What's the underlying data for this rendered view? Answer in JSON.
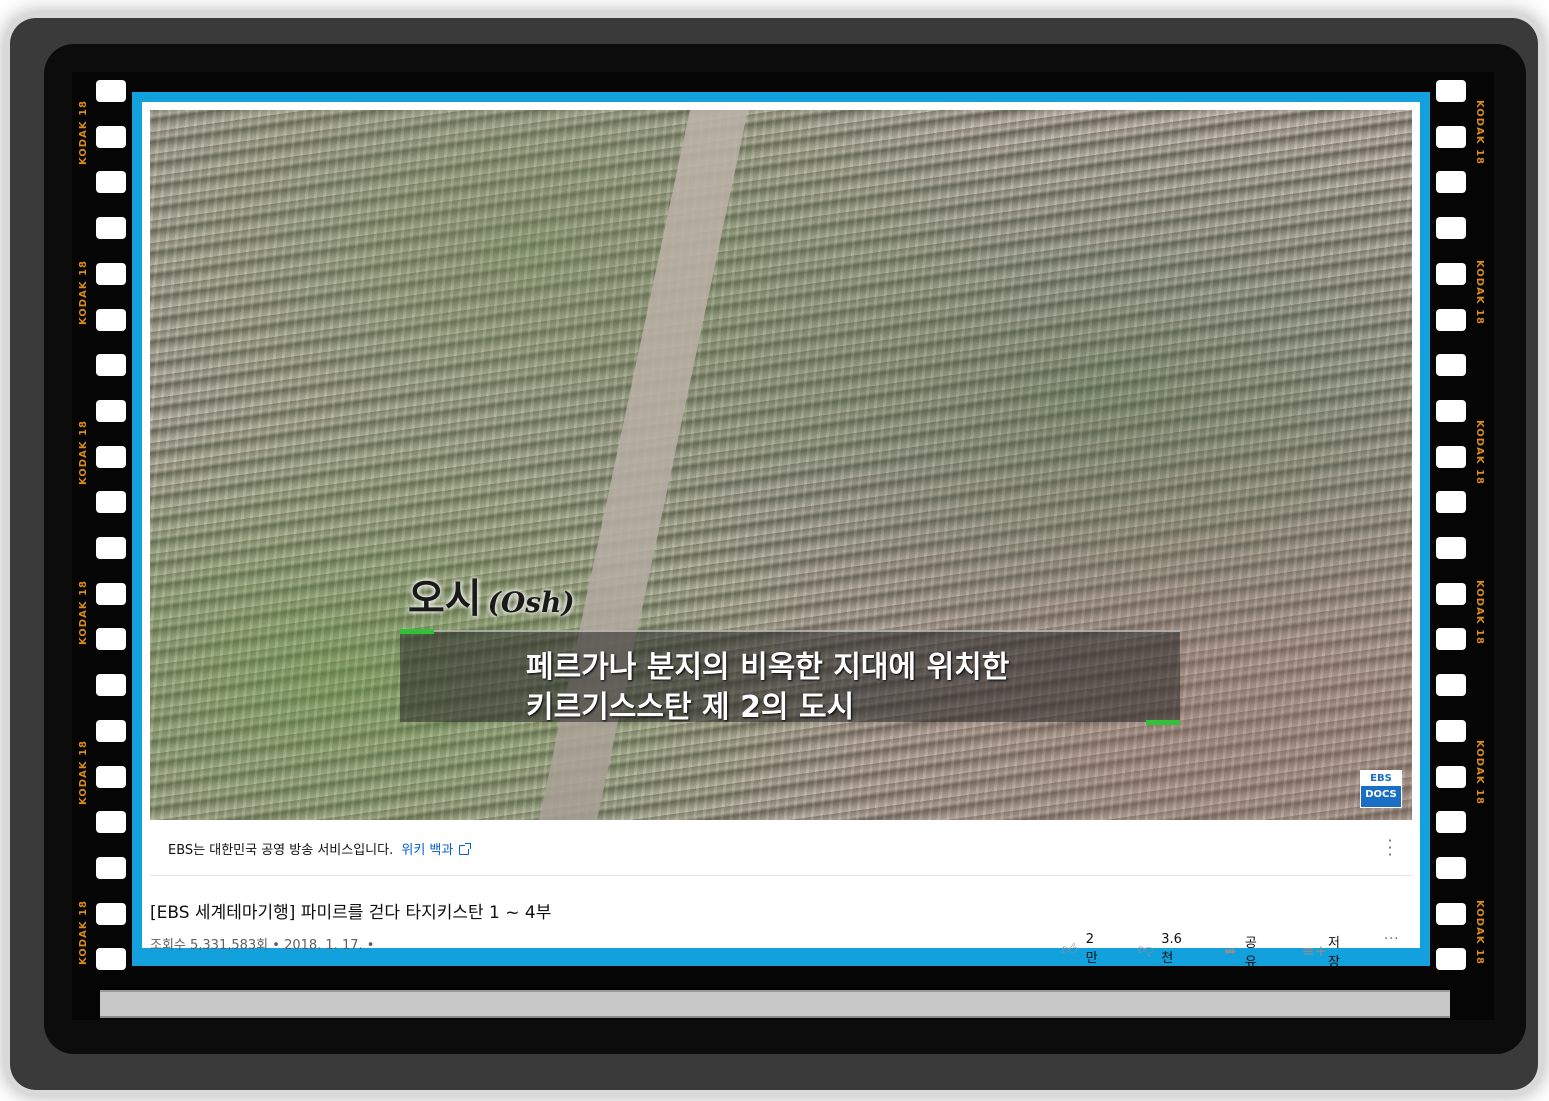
{
  "video": {
    "place_name": "오시",
    "place_name_latin": "(Osh)",
    "subtitle_line1": "페르가나 분지의 비옥한 지대에 위치한",
    "subtitle_line2": "키르기스스탄 제 2의 도시",
    "logo_top": "EBS",
    "logo_bottom": "DOCS"
  },
  "info_bar": {
    "text": "EBS는 대한민국 공영 방송 서비스입니다.",
    "link": "위키 백과",
    "menu_icon": "kebab-icon"
  },
  "title": "[EBS 세계테마기행] 파미르를 걷다 타지키스탄 1 ~ 4부",
  "meta": "조회수 5,331,583회 • 2018. 1. 17. •",
  "actions": {
    "like": "2만",
    "dislike": "3.6천",
    "share": "공유",
    "save": "저장",
    "more": "···"
  },
  "film": {
    "mark": "KODAK 18",
    "accent_color": "#12a1dc",
    "mark_color": "#d98a1c"
  }
}
